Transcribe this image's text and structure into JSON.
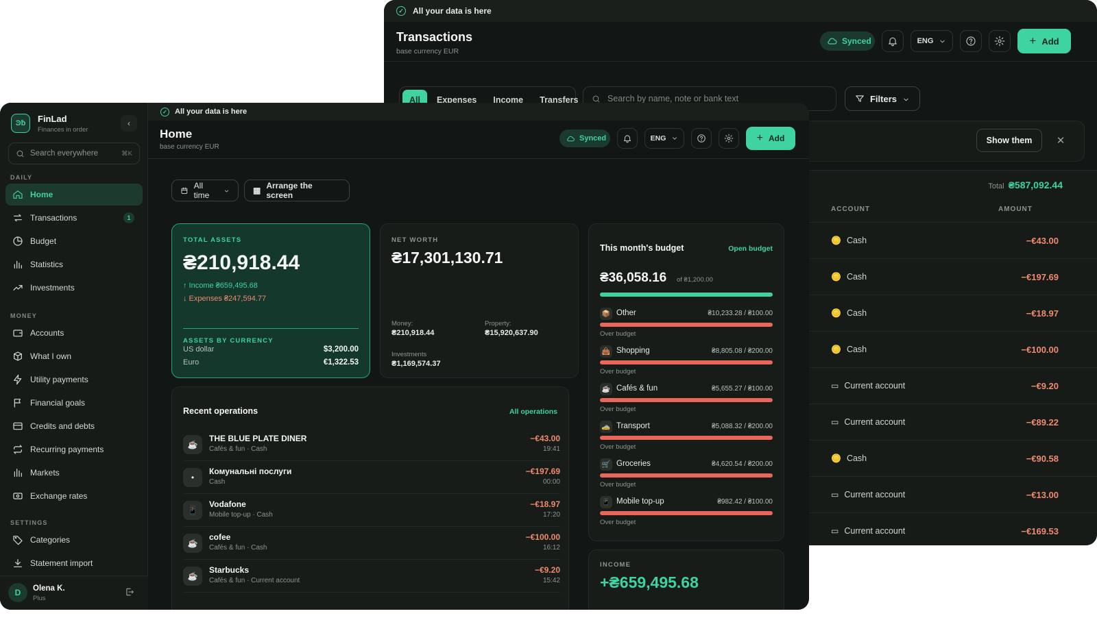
{
  "colors": {
    "accent": "#3fd3a2",
    "negative": "#f08a6f",
    "over_budget_bar": "#e8675a",
    "bg": "#121614"
  },
  "back": {
    "banner": "All your data is here",
    "title": "Transactions",
    "subtitle": "base currency EUR",
    "synced": "Synced",
    "lang": "ENG",
    "add": "Add",
    "tabs": [
      "All",
      "Expenses",
      "Income",
      "Transfers"
    ],
    "search_placeholder": "Search by name, note or bank text",
    "filters": "Filters",
    "show_them": "Show them",
    "total_label": "Total",
    "total_value": "₴587,092.44",
    "col_account": "ACCOUNT",
    "col_amount": "AMOUNT",
    "rows": [
      {
        "account": "Cash",
        "icon": "cash-icon",
        "amount": "−€43.00"
      },
      {
        "account": "Cash",
        "icon": "cash-icon",
        "amount": "−€197.69"
      },
      {
        "account": "Cash",
        "icon": "cash-icon",
        "amount": "−€18.97"
      },
      {
        "account": "Cash",
        "icon": "cash-icon",
        "amount": "−€100.00"
      },
      {
        "account": "Current account",
        "icon": "card-icon",
        "amount": "−€9.20"
      },
      {
        "account": "Current account",
        "icon": "card-icon",
        "amount": "−€89.22"
      },
      {
        "account": "Cash",
        "icon": "cash-icon",
        "amount": "−€90.58"
      },
      {
        "account": "Current account",
        "icon": "card-icon",
        "amount": "−€13.00"
      },
      {
        "account": "Current account",
        "icon": "card-icon",
        "amount": "−€169.53"
      }
    ]
  },
  "sidebar": {
    "app_name": "FinLad",
    "tagline": "Finances in order",
    "search_placeholder": "Search everywhere",
    "search_shortcut": "⌘K",
    "sections": {
      "daily": "DAILY",
      "money": "MONEY",
      "settings": "SETTINGS"
    },
    "daily": [
      {
        "label": "Home",
        "icon": "home-icon",
        "active": true
      },
      {
        "label": "Transactions",
        "icon": "transfer-icon",
        "badge": "1"
      },
      {
        "label": "Budget",
        "icon": "pie-icon"
      },
      {
        "label": "Statistics",
        "icon": "bar-chart-icon"
      },
      {
        "label": "Investments",
        "icon": "trend-icon"
      }
    ],
    "money": [
      {
        "label": "Accounts",
        "icon": "wallet-icon"
      },
      {
        "label": "What I own",
        "icon": "box-icon"
      },
      {
        "label": "Utility payments",
        "icon": "bolt-icon"
      },
      {
        "label": "Financial goals",
        "icon": "flag-icon"
      },
      {
        "label": "Credits and debts",
        "icon": "credit-card-icon"
      },
      {
        "label": "Recurring payments",
        "icon": "repeat-icon"
      },
      {
        "label": "Markets",
        "icon": "markets-icon"
      },
      {
        "label": "Exchange rates",
        "icon": "exchange-icon"
      }
    ],
    "settings": [
      {
        "label": "Categories",
        "icon": "tag-icon"
      },
      {
        "label": "Statement import",
        "icon": "import-icon"
      }
    ],
    "user": {
      "initial": "D",
      "name": "Olena K.",
      "plan": "Plus"
    }
  },
  "main": {
    "banner": "All your data is here",
    "title": "Home",
    "subtitle": "base currency EUR",
    "synced": "Synced",
    "lang": "ENG",
    "add": "Add",
    "period": "All time",
    "arrange": "Arrange the screen",
    "total_assets": {
      "label": "TOTAL ASSETS",
      "value": "₴210,918.44",
      "income": "↑ Income ₴659,495.68",
      "expenses": "↓ Expenses ₴247,594.77",
      "by_currency_label": "ASSETS BY CURRENCY",
      "currencies": [
        {
          "name": "US dollar",
          "value": "$3,200.00"
        },
        {
          "name": "Euro",
          "value": "€1,322.53"
        }
      ]
    },
    "net_worth": {
      "label": "NET WORTH",
      "value": "₴17,301,130.71",
      "money_label": "Money:",
      "money": "₴210,918.44",
      "property_label": "Property:",
      "property": "₴15,920,637.90",
      "investments_label": "Investments",
      "investments": "₴1,169,574.37"
    },
    "budget": {
      "title": "This month's budget",
      "link": "Open budget",
      "value": "₴36,058.16",
      "of": "of ₴1,200.00",
      "progress": 1.0,
      "items": [
        {
          "name": "Other",
          "value": "₴10,233.28 / ₴100.00",
          "note": "Over budget",
          "icon": "📦"
        },
        {
          "name": "Shopping",
          "value": "₴8,805.08 / ₴200.00",
          "note": "Over budget",
          "icon": "👜"
        },
        {
          "name": "Cafés & fun",
          "value": "₴5,655.27 / ₴100.00",
          "note": "Over budget",
          "icon": "☕"
        },
        {
          "name": "Transport",
          "value": "₴5,088.32 / ₴200.00",
          "note": "Over budget",
          "icon": "🚕"
        },
        {
          "name": "Groceries",
          "value": "₴4,620.54 / ₴200.00",
          "note": "Over budget",
          "icon": "🛒"
        },
        {
          "name": "Mobile top-up",
          "value": "₴982.42 / ₴100.00",
          "note": "Over budget",
          "icon": "📱"
        }
      ]
    },
    "recent": {
      "title": "Recent operations",
      "link": "All operations",
      "items": [
        {
          "name": "THE BLUE PLATE DINER",
          "sub": "Cafés & fun · Cash",
          "amount": "−€43.00",
          "time": "19:41",
          "icon": "☕"
        },
        {
          "name": "Комунальні послуги",
          "sub": "Cash",
          "amount": "−€197.69",
          "time": "00:00",
          "icon": "•"
        },
        {
          "name": "Vodafone",
          "sub": "Mobile top-up · Cash",
          "amount": "−€18.97",
          "time": "17:20",
          "icon": "📱"
        },
        {
          "name": "cofee",
          "sub": "Cafés & fun · Cash",
          "amount": "−€100.00",
          "time": "16:12",
          "icon": "☕"
        },
        {
          "name": "Starbucks",
          "sub": "Cafés & fun · Current account",
          "amount": "−€9.20",
          "time": "15:42",
          "icon": "☕"
        }
      ]
    },
    "income": {
      "label": "INCOME",
      "value": "+₴659,495.68"
    }
  }
}
